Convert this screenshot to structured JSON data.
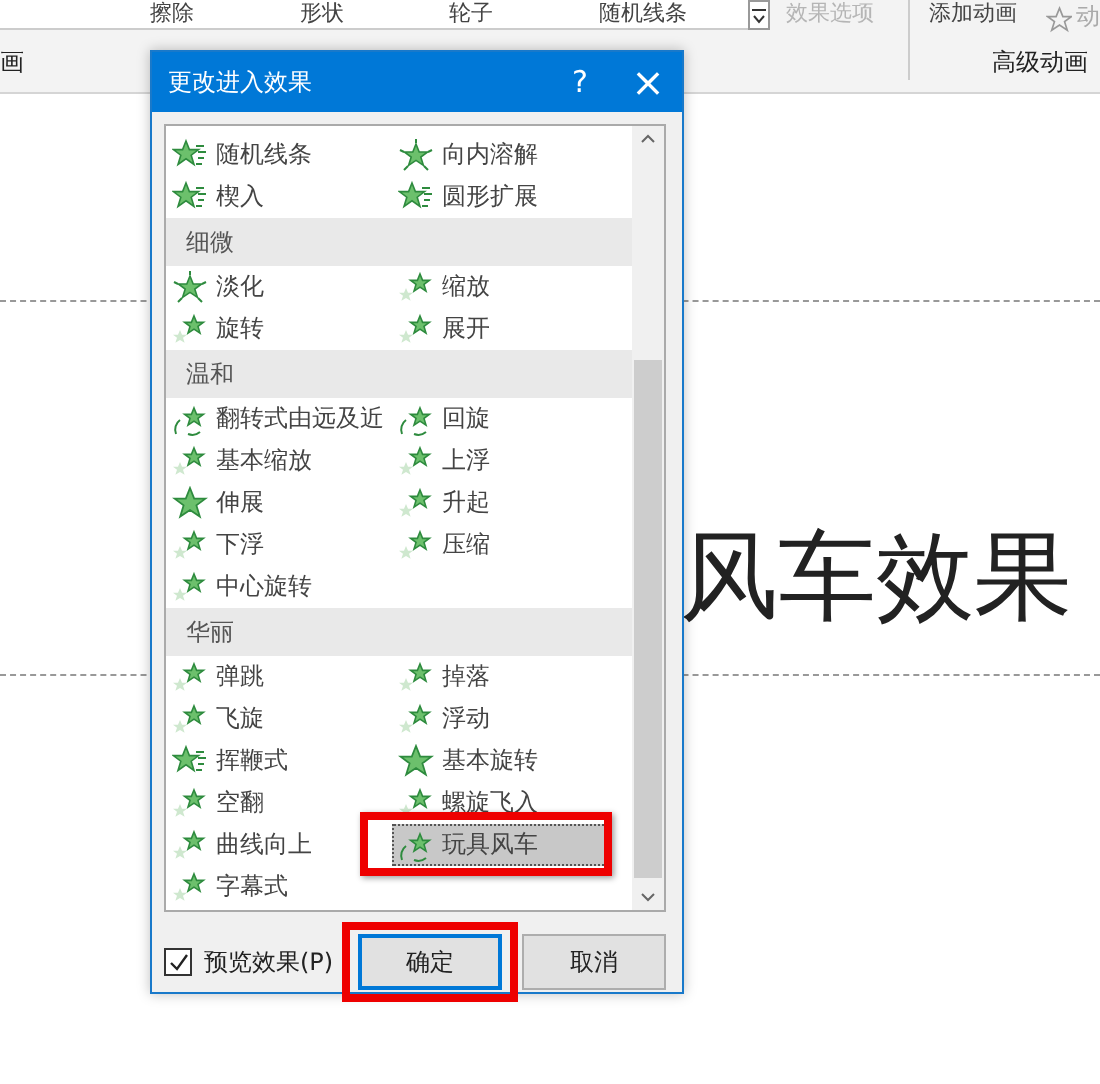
{
  "ribbon": {
    "gallery": [
      "擦除",
      "形状",
      "轮子",
      "随机线条"
    ],
    "effect_options": {
      "label": "效果选项",
      "disabled": true
    },
    "add_animation": "添加动画",
    "partial": "动",
    "group_left": "画",
    "group_right": "高级动画"
  },
  "slide": {
    "title": "风车效果"
  },
  "dialog": {
    "title": "更改进入效果",
    "help": "?",
    "close": "×",
    "sections": [
      {
        "items": [
          {
            "label": "随机线条",
            "kind": "lines",
            "selected": false
          },
          {
            "label": "向内溶解",
            "kind": "burst",
            "selected": false
          },
          {
            "label": "楔入",
            "kind": "lines",
            "selected": false
          },
          {
            "label": "圆形扩展",
            "kind": "lines",
            "selected": false
          }
        ]
      },
      {
        "heading": "细微",
        "items": [
          {
            "label": "淡化",
            "kind": "burst",
            "selected": false
          },
          {
            "label": "缩放",
            "kind": "twin",
            "selected": false
          },
          {
            "label": "旋转",
            "kind": "twin",
            "selected": false
          },
          {
            "label": "展开",
            "kind": "twin",
            "selected": false
          }
        ]
      },
      {
        "heading": "温和",
        "items": [
          {
            "label": "翻转式由远及近",
            "kind": "spin",
            "selected": false
          },
          {
            "label": "回旋",
            "kind": "spin",
            "selected": false
          },
          {
            "label": "基本缩放",
            "kind": "twin",
            "selected": false
          },
          {
            "label": "上浮",
            "kind": "twin",
            "selected": false
          },
          {
            "label": "伸展",
            "kind": "star",
            "selected": false
          },
          {
            "label": "升起",
            "kind": "twin",
            "selected": false
          },
          {
            "label": "下浮",
            "kind": "twin",
            "selected": false
          },
          {
            "label": "压缩",
            "kind": "twin",
            "selected": false
          },
          {
            "label": "中心旋转",
            "kind": "twin",
            "selected": false
          }
        ]
      },
      {
        "heading": "华丽",
        "items": [
          {
            "label": "弹跳",
            "kind": "twin",
            "selected": false
          },
          {
            "label": "掉落",
            "kind": "twin",
            "selected": false
          },
          {
            "label": "飞旋",
            "kind": "twin",
            "selected": false
          },
          {
            "label": "浮动",
            "kind": "twin",
            "selected": false
          },
          {
            "label": "挥鞭式",
            "kind": "lines",
            "selected": false
          },
          {
            "label": "基本旋转",
            "kind": "star",
            "selected": false
          },
          {
            "label": "空翻",
            "kind": "twin",
            "selected": false
          },
          {
            "label": "螺旋飞入",
            "kind": "twin",
            "selected": false
          },
          {
            "label": "曲线向上",
            "kind": "twin",
            "selected": false
          },
          {
            "label": "玩具风车",
            "kind": "spin",
            "selected": true,
            "annotated": true
          },
          {
            "label": "字幕式",
            "kind": "twin",
            "selected": false
          }
        ]
      }
    ],
    "preview": {
      "label": "预览效果(P)",
      "checked": true
    },
    "ok": {
      "label": "确定",
      "annotated": true
    },
    "cancel": {
      "label": "取消"
    }
  }
}
